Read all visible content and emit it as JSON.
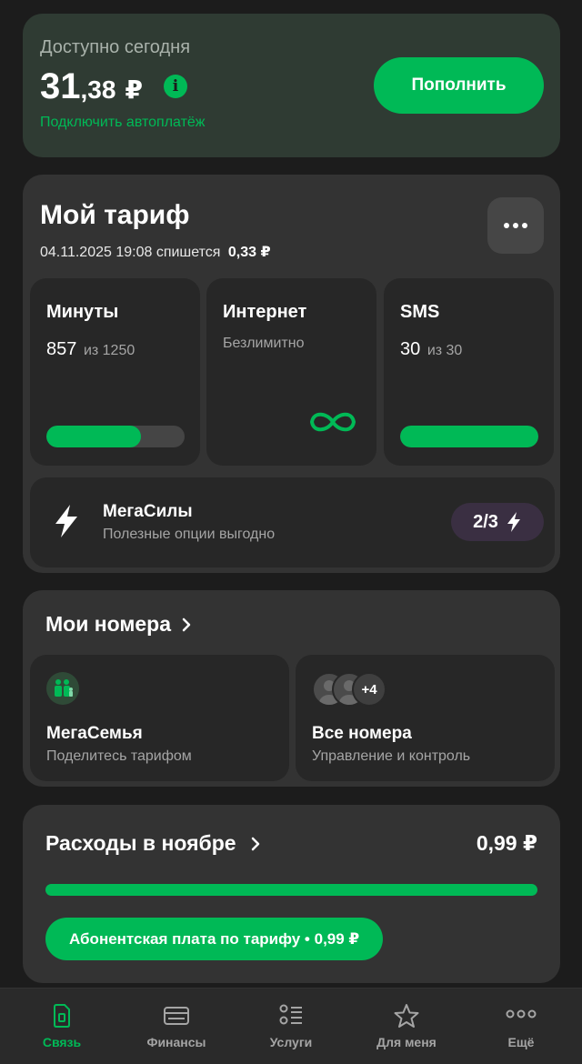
{
  "balance": {
    "label": "Доступно сегодня",
    "amount_int": "31",
    "amount_dec": ",38",
    "currency": "₽",
    "info": "i",
    "autopay_link": "Подключить автоплатёж",
    "topup_button": "Пополнить"
  },
  "tariff": {
    "title": "Мой тариф",
    "charge_date": "04.11.2025 19:08 спишется",
    "charge_amount": "0,33 ₽",
    "tiles": [
      {
        "title": "Минуты",
        "value": "857",
        "of": "из 1250",
        "progress": 0.686
      },
      {
        "title": "Интернет",
        "value": "Безлимитно"
      },
      {
        "title": "SMS",
        "value": "30",
        "of": "из 30",
        "progress": 1.0
      }
    ],
    "megasily": {
      "title": "МегаСилы",
      "subtitle": "Полезные опции выгодно",
      "badge": "2/3"
    }
  },
  "numbers": {
    "title": "Мои номера",
    "family": {
      "title": "МегаСемья",
      "subtitle": "Поделитесь тарифом"
    },
    "all": {
      "title": "Все номера",
      "subtitle": "Управление и контроль",
      "extra_count": "+4"
    }
  },
  "expenses": {
    "title": "Расходы в ноябре",
    "amount": "0,99 ₽",
    "progress": 1.0,
    "chip": "Абонентская плата по тарифу • 0,99 ₽"
  },
  "nav": [
    {
      "label": "Связь",
      "icon": "sim-icon",
      "active": true
    },
    {
      "label": "Финансы",
      "icon": "wallet-icon",
      "active": false
    },
    {
      "label": "Услуги",
      "icon": "services-icon",
      "active": false
    },
    {
      "label": "Для меня",
      "icon": "star-icon",
      "active": false
    },
    {
      "label": "Ещё",
      "icon": "more-icon",
      "active": false
    }
  ],
  "colors": {
    "accent": "#00b956",
    "background": "#1c1c1c",
    "card": "#333333",
    "tile": "#272727",
    "balance_card": "#2f3b33",
    "badge": "#3a2f42"
  }
}
